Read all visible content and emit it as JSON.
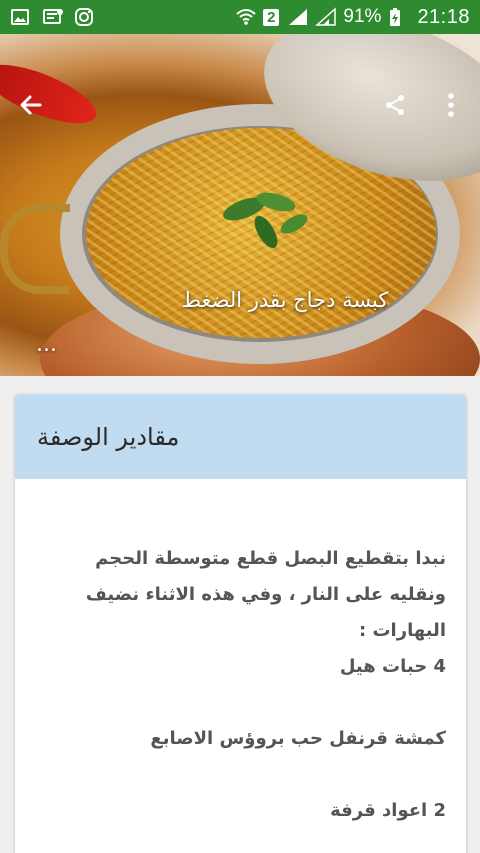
{
  "status_bar": {
    "battery_text": "91%",
    "time": "21:18",
    "sim_badge": "2"
  },
  "recipe": {
    "title": "كبسة دجاج بقدر الضغط",
    "more_indicator": "..."
  },
  "card": {
    "header": "مقادير الوصفة",
    "paragraph": "نبدا بتقطيع البصل قطع متوسطة الحجم ونقليه على النار ، وفي هذه الاثناء نضيف البهارات :",
    "items": [
      "4 حبات هيل",
      "كمشة قرنفل حب بروؤس الاصابع",
      "2 اعواد قرفة"
    ]
  },
  "colors": {
    "status_bar": "#2e8b2f",
    "card_header": "#c1dcf0"
  }
}
